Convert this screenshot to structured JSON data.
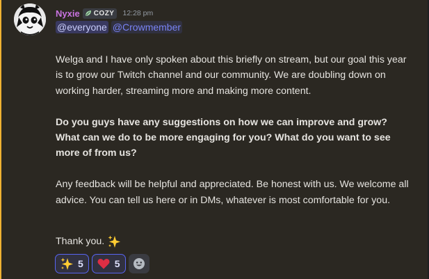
{
  "message": {
    "author": {
      "name": "Nyxie",
      "name_color": "#c873e0",
      "tag": "COZY",
      "tag_icon": "leaf-icon",
      "avatar": "avatar-icon"
    },
    "timestamp": "12:28 pm",
    "mentions": [
      "@everyone",
      "@Crowmember"
    ],
    "paragraphs": [
      "Welga and I have only spoken about this briefly on stream, but our goal this year is to grow our Twitch channel and our community. We are doubling down on working harder, streaming more and making more content.",
      "Do you guys have any suggestions on how we can improve and grow? What can we do to be more engaging for you? What do you want to see more of from us?",
      "Any feedback will be helpful and appreciated. Be honest with us. We welcome all advice. You can tell us here or in DMs, whatever is most comfortable for you."
    ],
    "closing": "Thank you.",
    "closing_emoji": "sparkles-icon",
    "highlight_color": "#f0b232"
  },
  "reactions": [
    {
      "emoji": "sparkles-icon",
      "count": "5"
    },
    {
      "emoji": "heart-icon",
      "count": "5"
    }
  ],
  "add_reaction": {
    "icon": "add-reaction-icon"
  }
}
